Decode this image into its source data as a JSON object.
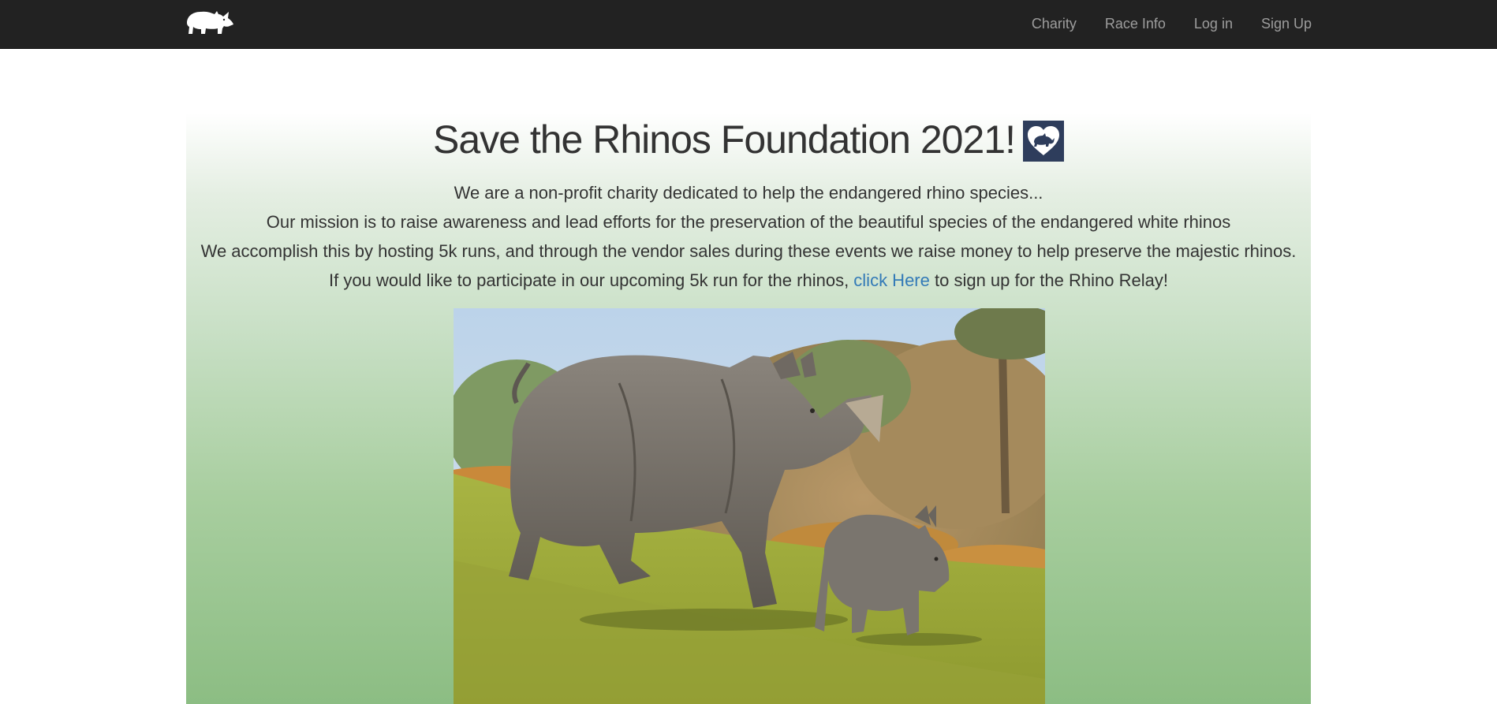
{
  "navbar": {
    "brand_icon": "rhino-logo-icon",
    "links": [
      {
        "label": "Charity"
      },
      {
        "label": "Race Info"
      },
      {
        "label": "Log in"
      },
      {
        "label": "Sign Up"
      }
    ]
  },
  "hero": {
    "title": "Save the Rhinos Foundation 2021!",
    "title_icon": "heart-rhino-icon",
    "lines": [
      "We are a non-profit charity dedicated to help the endangered rhino species...",
      "Our mission is to raise awareness and lead efforts for the preservation of the beautiful species of the endangered white rhinos",
      "We accomplish this by hosting 5k runs, and through the vendor sales during these events we raise money to help preserve the majestic rhinos."
    ],
    "cta": {
      "before": "If you would like to participate in our upcoming 5k run for the rhinos, ",
      "link": "click Here",
      "after": " to sign up for the Rhino Relay!"
    },
    "photo_subject": "white-rhino-mother-and-calf-photo"
  },
  "colors": {
    "navbar_bg": "#222222",
    "nav_link": "#9d9d9d",
    "text": "#333333",
    "link": "#337ab7",
    "gradient_bottom": "#8cbd83",
    "badge_bg": "#2e3d5c"
  }
}
